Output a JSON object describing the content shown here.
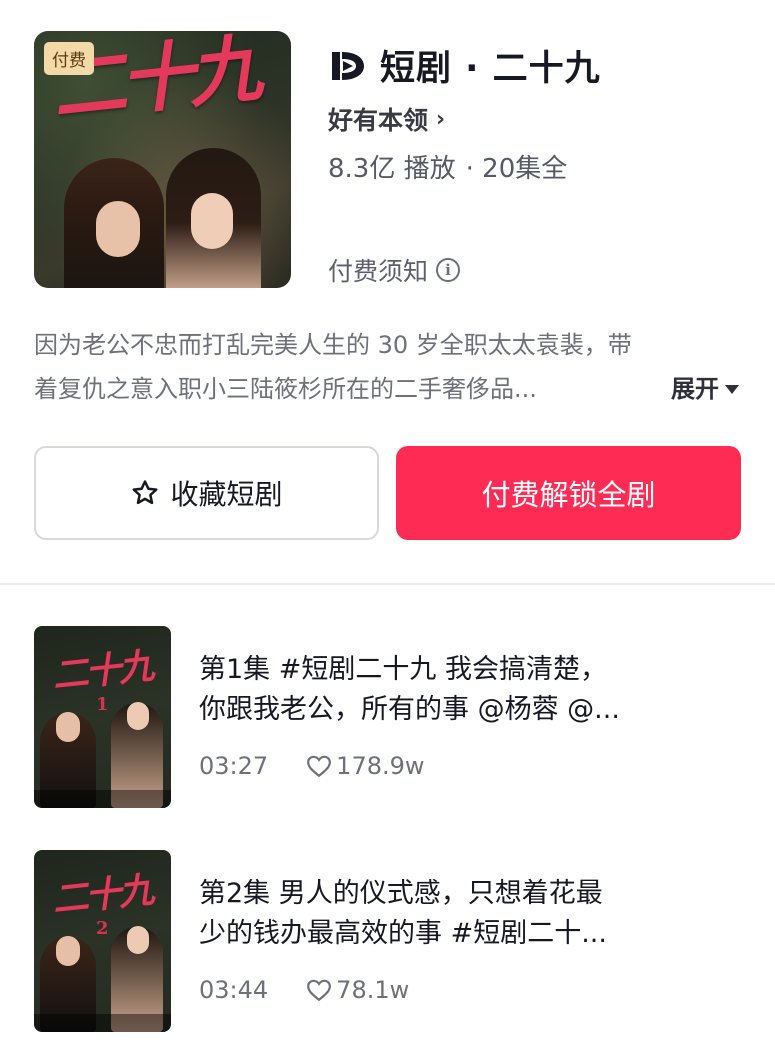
{
  "drama": {
    "cover_badge": "付费",
    "cover_art_title": "二十九",
    "title": "短剧 · 二十九",
    "author": "好有本领",
    "play_count": "8.3亿 播放",
    "episodes_total": "· 20集全",
    "notice": "付费须知",
    "description_line1": "因为老公不忠而打乱完美人生的 30 岁全职太太袁裴，带",
    "description_line2": "着复仇之意入职小三陆筱杉所在的二手奢侈品...",
    "expand_label": "展开"
  },
  "actions": {
    "favorite_label": "收藏短剧",
    "unlock_label": "付费解锁全剧"
  },
  "episodes": [
    {
      "thumb_art": "二十九",
      "thumb_number": "1",
      "title_line1": "第1集   #短剧二十九 我会搞清楚，",
      "title_line2": "你跟我老公，所有的事 @杨蓉 @...",
      "duration": "03:27",
      "likes": "178.9w"
    },
    {
      "thumb_art": "二十九",
      "thumb_number": "2",
      "title_line1": "第2集   男人的仪式感，只想着花最",
      "title_line2": "少的钱办最高效的事 #短剧二十...",
      "duration": "03:44",
      "likes": "78.1w"
    }
  ],
  "colors": {
    "accent": "#fe2c55",
    "badge_bg": "#f4d9a8",
    "text_primary": "#161823",
    "text_secondary": "#6e717a"
  }
}
